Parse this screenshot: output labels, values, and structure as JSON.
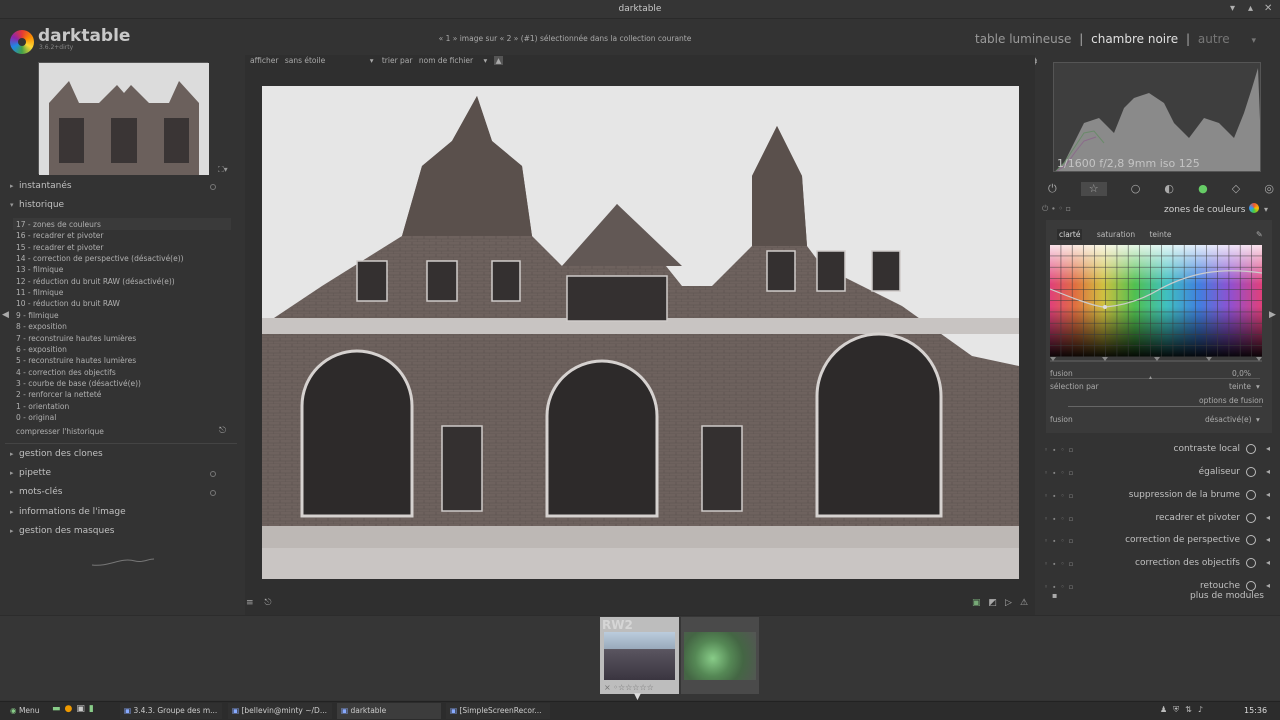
{
  "window": {
    "title": "darktable"
  },
  "app": {
    "name": "darktable",
    "version": "3.6.2+dirty"
  },
  "header": {
    "selection_info": "« 1 » image sur « 2 » (#1) sélectionnée dans la collection courante",
    "views": [
      "table lumineuse",
      "chambre noire",
      "autre"
    ],
    "separator": "|",
    "icons": [
      "G",
      "☆",
      "?",
      "⚙"
    ]
  },
  "center_top": {
    "show_label": "afficher",
    "show_value": "sans étoile",
    "sort_label": "trier par",
    "sort_value": "nom de fichier"
  },
  "left": {
    "snapshots": "instantanés",
    "history_title": "historique",
    "history": [
      "17 - zones de couleurs",
      "16 - recadrer et pivoter",
      "15 - recadrer et pivoter",
      "14 - correction de perspective (désactivé(e))",
      "13 - filmique",
      "12 - réduction du bruit RAW (désactivé(e))",
      "11 - filmique",
      "10 - réduction du bruit RAW",
      "9 - filmique",
      "8 - exposition",
      "7 - reconstruire hautes lumières",
      "6 - exposition",
      "5 - reconstruire hautes lumières",
      "4 - correction des objectifs",
      "3 - courbe de base (désactivé(e))",
      "2 - renforcer la netteté",
      "1 - orientation",
      "0 - original"
    ],
    "compress": "compresser l'historique",
    "sections": [
      "gestion des clones",
      "pipette",
      "mots-clés",
      "informations de l'image",
      "gestion des masques"
    ]
  },
  "right": {
    "exif": "1/1600 f/2,8 9mm iso 125",
    "active_module": "zones de couleurs",
    "cz_tabs": [
      "clarté",
      "saturation",
      "teinte"
    ],
    "fusion_label": "fusion",
    "fusion_value": "0,0%",
    "select_by_label": "sélection par",
    "select_by_value": "teinte",
    "blend_options": "options de fusion",
    "blend_label": "fusion",
    "blend_value": "désactivé(e)",
    "modules": [
      "contraste local",
      "égaliseur",
      "suppression de la brume",
      "recadrer et pivoter",
      "correction de perspective",
      "correction des objectifs",
      "retouche"
    ],
    "more_modules": "plus de modules"
  },
  "filmstrip": {
    "thumb1_label": "RW2"
  },
  "taskbar": {
    "menu": "Menu",
    "items": [
      "3.4.3. Groupe des m...",
      "[bellevin@minty ~/D...",
      "darktable",
      "[SimpleScreenRecor..."
    ],
    "clock": "15:36"
  }
}
